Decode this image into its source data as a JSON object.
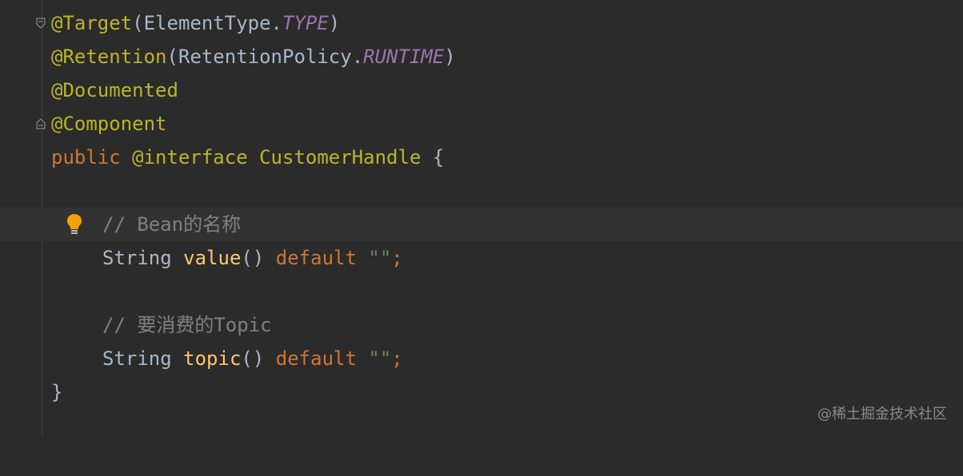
{
  "editor": {
    "lines": {
      "l1": {
        "ann": "@Target",
        "open": "(",
        "cls": "ElementType.",
        "const": "TYPE",
        "close": ")"
      },
      "l2": {
        "ann": "@Retention",
        "open": "(",
        "cls": "RetentionPolicy.",
        "const": "RUNTIME",
        "close": ")"
      },
      "l3": {
        "ann": "@Documented"
      },
      "l4": {
        "ann": "@Component"
      },
      "l5": {
        "kw": "public",
        "sp1": " ",
        "kw2": "@interface",
        "sp2": " ",
        "name": "CustomerHandle",
        "brace": " {"
      },
      "l7": {
        "comment": "// Bean的名称"
      },
      "l8": {
        "type": "String",
        "sp": " ",
        "method": "value",
        "parens": "()",
        "sp2": " ",
        "kw": "default",
        "sp3": " ",
        "str": "\"\"",
        "semi": ";"
      },
      "l10": {
        "comment": "// 要消费的Topic"
      },
      "l11": {
        "type": "String",
        "sp": " ",
        "method": "topic",
        "parens": "()",
        "sp2": " ",
        "kw": "default",
        "sp3": " ",
        "str": "\"\"",
        "semi": ";"
      },
      "l12": {
        "brace": "}"
      }
    },
    "intention_icon": "lightbulb-icon",
    "fold_icon": "fold-marker-icon"
  },
  "watermark": {
    "text": "@稀土掘金技术社区"
  },
  "colors": {
    "background": "#2b2b2b",
    "annotation": "#bbb529",
    "keyword": "#cc7832",
    "method": "#ffc66d",
    "constant": "#9876aa",
    "string": "#6a8759",
    "comment": "#808080",
    "text": "#a9b7c6"
  }
}
